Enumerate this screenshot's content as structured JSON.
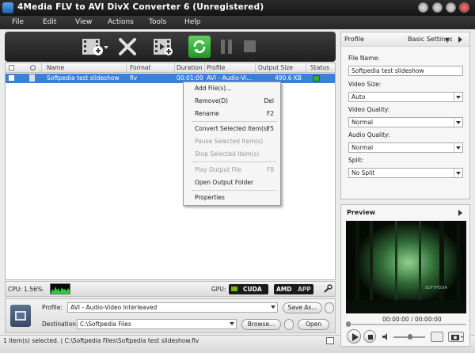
{
  "window": {
    "title": "4Media FLV to AVI DivX Converter 6 (Unregistered)"
  },
  "menu": [
    "File",
    "Edit",
    "View",
    "Actions",
    "Tools",
    "Help"
  ],
  "grid": {
    "columns": [
      "Name",
      "Format",
      "Duration",
      "Profile",
      "Output Size",
      "Status"
    ],
    "rows": [
      {
        "name": "Softpedia test slideshow",
        "format": "flv",
        "duration": "00:01:09",
        "profile": "AVI - Audio-Vi...",
        "output_size": "490.6 KB"
      }
    ]
  },
  "context_menu": {
    "items": [
      {
        "label": "Add File(s)...",
        "shortcut": "",
        "enabled": true
      },
      {
        "label": "Remove(D)",
        "shortcut": "Del",
        "enabled": true
      },
      {
        "label": "Rename",
        "shortcut": "F2",
        "enabled": true
      },
      {
        "label": "Convert Selected Item(s)",
        "shortcut": "F5",
        "enabled": true
      },
      {
        "label": "Pause Selected Item(s)",
        "shortcut": "",
        "enabled": false
      },
      {
        "label": "Stop Selected Item(s)",
        "shortcut": "",
        "enabled": false
      },
      {
        "label": "Play Output File",
        "shortcut": "F8",
        "enabled": false
      },
      {
        "label": "Open Output Folder",
        "shortcut": "",
        "enabled": true
      },
      {
        "label": "Properties",
        "shortcut": "",
        "enabled": true
      }
    ]
  },
  "status_row": {
    "cpu_label": "CPU: 1.56%",
    "gpu_label": "GPU:",
    "cuda": "CUDA",
    "amd": "AMD",
    "app": "APP"
  },
  "bottom": {
    "profile_label": "Profile:",
    "profile_value": "AVI - Audio-Video Interleaved",
    "save_as": "Save As...",
    "destination_label": "Destination:",
    "destination_value": "C:\\Softpedia Files",
    "browse": "Browse...",
    "open": "Open"
  },
  "statusbar": {
    "text": "1 item(s) selected. | C:\\Softpedia Files\\Softpedia test slideshow.flv"
  },
  "right_panel": {
    "title": "Profile",
    "settings_label": "Basic Settings",
    "file_name_label": "File Name:",
    "file_name_value": "Softpedia test slideshow",
    "video_size_label": "Video Size:",
    "video_size_value": "Auto",
    "video_quality_label": "Video Quality:",
    "video_quality_value": "Normal",
    "audio_quality_label": "Audio Quality:",
    "audio_quality_value": "Normal",
    "split_label": "Split:",
    "split_value": "No Split"
  },
  "preview": {
    "title": "Preview",
    "time": "00:00:00 / 00:00:00",
    "watermark": "SOFTPEDIA"
  },
  "colors": {
    "accent": "#3b7fd6",
    "toolbar": "#2a2a2a",
    "green": "#3aa83a"
  }
}
